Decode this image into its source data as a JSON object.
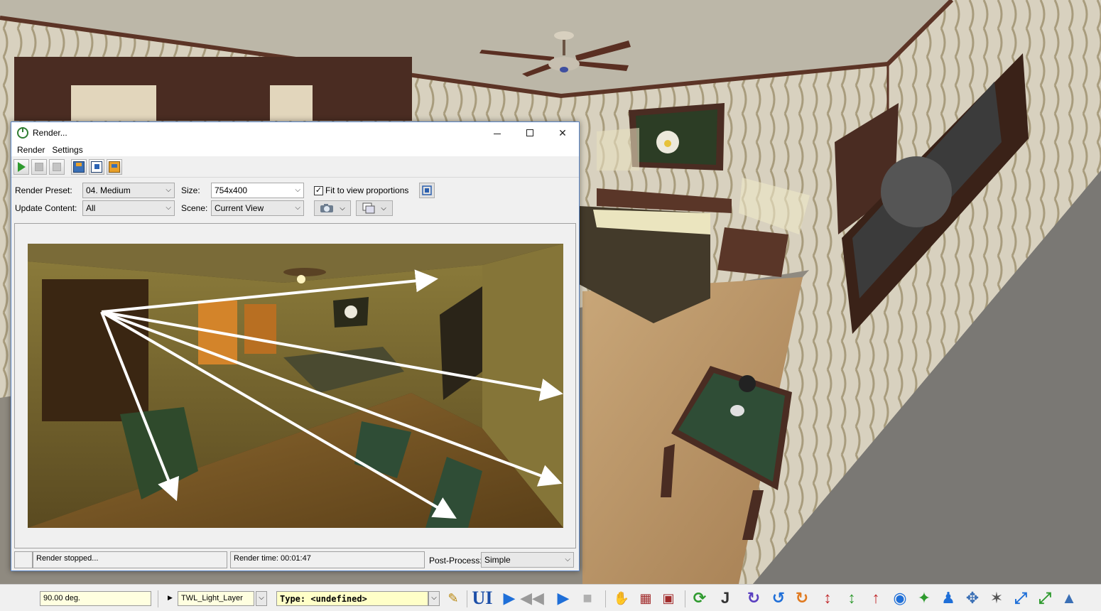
{
  "window": {
    "title": "Render...",
    "minimize": "",
    "maximize": "",
    "close": "✕"
  },
  "menu": [
    "Render",
    "Settings"
  ],
  "form": {
    "preset_label": "Render Preset:",
    "preset_value": "04. Medium",
    "size_label": "Size:",
    "size_value": "754x400",
    "fit_label": "Fit to view proportions",
    "fit_checked": true,
    "update_label": "Update Content:",
    "update_value": "All",
    "scene_label": "Scene:",
    "scene_value": "Current View"
  },
  "status": {
    "message": "Render stopped...",
    "render_time": "Render time: 00:01:47",
    "postprocess_label": "Post-Process:",
    "postprocess_value": "Simple"
  },
  "bottom_toolbar": {
    "angle_value": "90.00 deg.",
    "layer_value": "TWL_Light_Layer",
    "type_value": "Type: <undefined>",
    "ui_label": "UI"
  },
  "icons": {
    "play": "play-icon",
    "pause": "pause-icon",
    "stop": "stop-icon",
    "save": "save-image-icon",
    "copy": "copy-image-icon",
    "export": "export-icon",
    "camera": "camera-icon",
    "clone": "clone-window-icon",
    "fit": "fit-view-icon"
  },
  "colors": {
    "accent": "#2e9a2e",
    "window_border": "#5a86c8",
    "field_yellow": "#ffffe0"
  }
}
